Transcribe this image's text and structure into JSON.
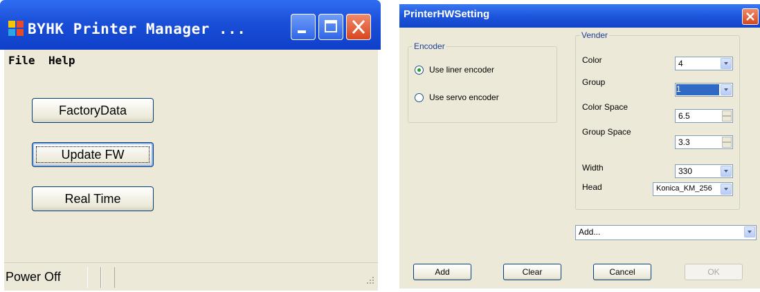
{
  "main_window": {
    "title": "BYHK Printer Manager ...",
    "menu": [
      "File",
      "Help"
    ],
    "buttons": {
      "factory_data": "FactoryData",
      "update_fw": "Update FW",
      "real_time": "Real Time"
    },
    "status": "Power Off"
  },
  "dialog": {
    "title": "PrinterHWSetting",
    "encoder": {
      "legend": "Encoder",
      "liner": "Use liner encoder",
      "servo": "Use servo encoder",
      "selected": "liner"
    },
    "vender": {
      "legend": "Vender",
      "color_label": "Color",
      "color_value": "4",
      "group_label": "Group",
      "group_value": "1",
      "color_space_label": "Color Space",
      "color_space_value": "6.5",
      "group_space_label": "Group Space",
      "group_space_value": "3.3",
      "width_label": "Width",
      "width_value": "330",
      "head_label": "Head",
      "head_value": "Konica_KM_256"
    },
    "add_combo": "Add...",
    "buttons": {
      "add": "Add",
      "clear": "Clear",
      "cancel": "Cancel",
      "ok": "OK"
    }
  },
  "colors": {
    "xp_blue": "#1a4fd8",
    "xp_face": "#ece9d8",
    "close_red": "#d8461f"
  },
  "icons": [
    "app-icon",
    "minimize-icon",
    "maximize-icon",
    "close-icon",
    "dropdown-arrow-icon",
    "spin-up-icon",
    "spin-down-icon",
    "resize-grip-icon"
  ]
}
